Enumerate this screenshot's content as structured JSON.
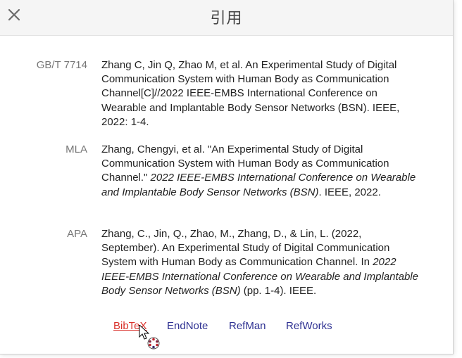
{
  "dialog": {
    "title": "引用",
    "close_icon": "close-icon"
  },
  "citations": [
    {
      "style": "GB/T 7714",
      "text": "Zhang C, Jin Q, Zhao M, et al. An Experimental Study of Digital Communication System with Human Body as Communication Channel[C]//2022 IEEE-EMBS International Conference on Wearable and Implantable Body Sensor Networks (BSN). IEEE, 2022: 1-4."
    },
    {
      "style": "MLA",
      "text_before": "Zhang, Chengyi, et al. \"An Experimental Study of Digital Communication System with Human Body as Communication Channel.\" ",
      "text_italic": "2022 IEEE-EMBS International Conference on Wearable and Implantable Body Sensor Networks (BSN)",
      "text_after": ". IEEE, 2022."
    },
    {
      "style": "APA",
      "text_before": "Zhang, C., Jin, Q., Zhao, M., Zhang, D., & Lin, L. (2022, September). An Experimental Study of Digital Communication System with Human Body as Communication Channel. In ",
      "text_italic": "2022 IEEE-EMBS International Conference on Wearable and Implantable Body Sensor Networks (BSN)",
      "text_after": " (pp. 1-4). IEEE."
    }
  ],
  "export_links": [
    {
      "label": "BibTeX",
      "state": "hovered"
    },
    {
      "label": "EndNote",
      "state": "normal"
    },
    {
      "label": "RefMan",
      "state": "normal"
    },
    {
      "label": "RefWorks",
      "state": "normal"
    }
  ],
  "colors": {
    "link": "#2e3192",
    "link_hover": "#d9312b",
    "label": "#777777",
    "text": "#222222",
    "header_bg": "#f5f5f5"
  },
  "cursor_icon": "busy-pointer-icon"
}
